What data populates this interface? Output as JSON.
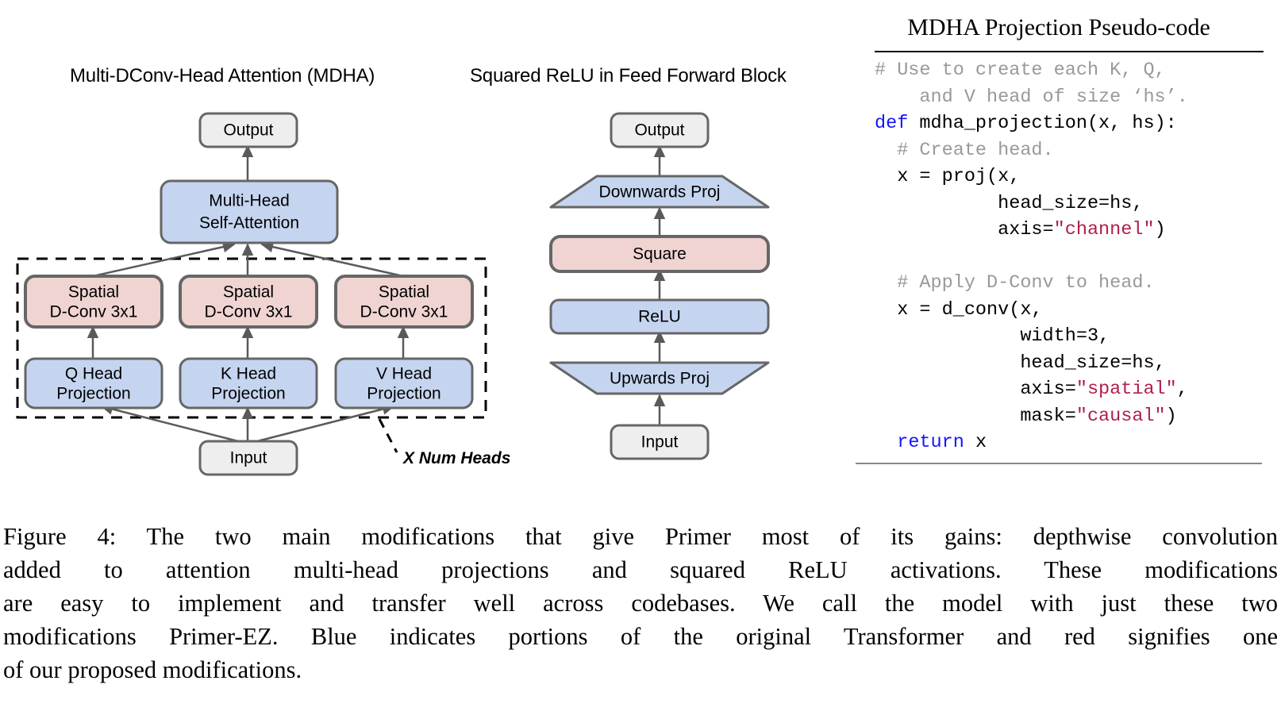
{
  "diagrams": {
    "mdha": {
      "title": "Multi-DConv-Head Attention (MDHA)",
      "nodes": {
        "output": "Output",
        "attention_line1": "Multi-Head",
        "attention_line2": "Self-Attention",
        "dconv_q_line1": "Spatial",
        "dconv_q_line2": "D-Conv 3x1",
        "dconv_k_line1": "Spatial",
        "dconv_k_line2": "D-Conv 3x1",
        "dconv_v_line1": "Spatial",
        "dconv_v_line2": "D-Conv 3x1",
        "q_head_line1": "Q Head",
        "q_head_line2": "Projection",
        "k_head_line1": "K Head",
        "k_head_line2": "Projection",
        "v_head_line1": "V Head",
        "v_head_line2": "Projection",
        "input": "Input",
        "num_heads_annotation": "X Num Heads"
      }
    },
    "feed_forward": {
      "title": "Squared ReLU in Feed Forward Block",
      "nodes": {
        "output": "Output",
        "downwards_proj": "Downwards Proj",
        "square": "Square",
        "relu": "ReLU",
        "upwards_proj": "Upwards Proj",
        "input": "Input"
      }
    }
  },
  "code_panel": {
    "title": "MDHA Projection Pseudo-code",
    "lines": [
      [
        {
          "t": "# Use to create each K, Q,",
          "c": "tok-comment"
        }
      ],
      [
        {
          "t": "    and V head of size ‘hs’.",
          "c": "tok-comment"
        }
      ],
      [
        {
          "t": "def",
          "c": "tok-kw"
        },
        {
          "t": " mdha_projection(x, hs):",
          "c": "tok-plain"
        }
      ],
      [
        {
          "t": "  # Create head.",
          "c": "tok-comment"
        }
      ],
      [
        {
          "t": "  x = proj(x,",
          "c": "tok-plain"
        }
      ],
      [
        {
          "t": "           head_size=hs,",
          "c": "tok-plain"
        }
      ],
      [
        {
          "t": "           axis=",
          "c": "tok-plain"
        },
        {
          "t": "\"channel\"",
          "c": "tok-str"
        },
        {
          "t": ")",
          "c": "tok-plain"
        }
      ],
      [
        {
          "t": " ",
          "c": "tok-plain"
        }
      ],
      [
        {
          "t": "  # Apply D-Conv to head.",
          "c": "tok-comment"
        }
      ],
      [
        {
          "t": "  x = d_conv(x,",
          "c": "tok-plain"
        }
      ],
      [
        {
          "t": "             width=3,",
          "c": "tok-plain"
        }
      ],
      [
        {
          "t": "             head_size=hs,",
          "c": "tok-plain"
        }
      ],
      [
        {
          "t": "             axis=",
          "c": "tok-plain"
        },
        {
          "t": "\"spatial\"",
          "c": "tok-str"
        },
        {
          "t": ",",
          "c": "tok-plain"
        }
      ],
      [
        {
          "t": "             mask=",
          "c": "tok-plain"
        },
        {
          "t": "\"causal\"",
          "c": "tok-str"
        },
        {
          "t": ")",
          "c": "tok-plain"
        }
      ],
      [
        {
          "t": "  ",
          "c": "tok-plain"
        },
        {
          "t": "return",
          "c": "tok-kw"
        },
        {
          "t": " x",
          "c": "tok-plain"
        }
      ]
    ]
  },
  "caption": {
    "lines": [
      "Figure 4: The two main modifications that give Primer most of its gains: depthwise convolution",
      "added to attention multi-head projections and squared ReLU activations.  These modifications",
      "are easy to implement and transfer well across codebases. We call the model with just these two",
      "modifications Primer-EZ. Blue indicates portions of the original Transformer and red signifies one",
      "of our proposed modifications."
    ],
    "full_text": "Figure 4: The two main modifications that give Primer most of its gains: depthwise convolution added to attention multi-head projections and squared ReLU activations. These modifications are easy to implement and transfer well across codebases. We call the model with just these two modifications Primer-EZ. Blue indicates portions of the original Transformer and red signifies one of our proposed modifications."
  },
  "colors": {
    "blue_fill": "#c5d5f0",
    "red_fill": "#f0d4d2",
    "grey_fill": "#eeeeee",
    "stroke": "#666666",
    "red_stroke": "#666666",
    "code_keyword": "#1414ff",
    "code_string": "#b02049",
    "code_comment": "#999999"
  }
}
